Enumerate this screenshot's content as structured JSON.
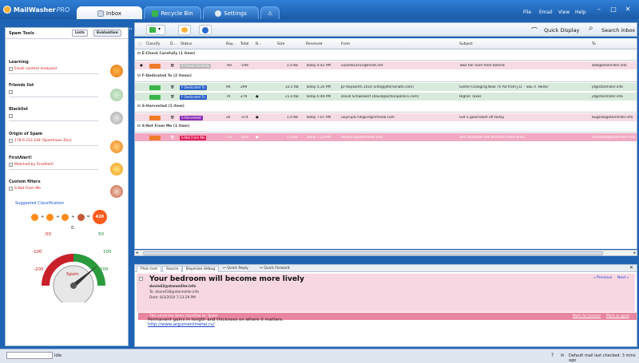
{
  "app": {
    "name": "MailWasher",
    "edition": "PRO"
  },
  "tabs": [
    {
      "label": "Inbox",
      "icon": "mail-icon"
    },
    {
      "label": "Recycle Bin",
      "icon": "recycle-icon"
    },
    {
      "label": "Settings",
      "icon": "gear-icon"
    },
    {
      "label": "",
      "icon": "warning-icon"
    }
  ],
  "menu": [
    "File",
    "Email",
    "View",
    "Help"
  ],
  "window": {
    "minimize": "–",
    "maximize": "□",
    "close": "✕"
  },
  "left": {
    "title": "Spam Tools",
    "seg_lists": "Lists",
    "seg_evaluation": "Evaluation",
    "tools": [
      {
        "title": "Learning",
        "value": "Email content analyzed",
        "badge": "70"
      },
      {
        "title": "Friends list",
        "value": ""
      },
      {
        "title": "Blacklist",
        "value": ""
      },
      {
        "title": "Origin of Spam",
        "value": "178.9.212.244 (Spamhaus Zen)",
        "badge": "100"
      },
      {
        "title": "FirstAlert!",
        "value": "Matched by FirstAlert!",
        "badge": "100"
      },
      {
        "title": "Custom filters",
        "value": "S-Not From Me",
        "badge": "150"
      }
    ],
    "suggested": "Suggested Classification",
    "total_score": "420",
    "gauge": {
      "labels": [
        "-200",
        "-100",
        "-50",
        "0",
        "50",
        "100",
        "200"
      ],
      "caption": "Spam",
      "needle_value": 420
    }
  },
  "toolbar": {
    "quick_display": "Quick Display",
    "search_inbox": "Search inbox"
  },
  "columns": [
    "Classify",
    "D...",
    "Status",
    "Bay...",
    "Total",
    "B...",
    "",
    "Size",
    "Received",
    "From",
    "Subject",
    "To"
  ],
  "groups": [
    {
      "label": "E-Check Carefully (1 item)",
      "rows": [
        {
          "style": "pink",
          "status": "E-Check Carefully",
          "status_color": "#b8b8b8",
          "bayes": "-69",
          "total": "-199",
          "attach": "",
          "size": "1.0 KB",
          "received": "Today 4:42 PM",
          "from": "vuzedos2010@hinet.net",
          "subject": "Take her hard from behind",
          "to": "web@stanmiller.info"
        }
      ]
    },
    {
      "label": "F-Dedicated To (2 items)",
      "rows": [
        {
          "style": "green",
          "status": "F-Dedicated To",
          "status_color": "#2a5fc8",
          "bayes": "99",
          "total": "299",
          "attach": "",
          "size": "33.5 KB",
          "received": "Today 5:35 PM",
          "from": "JD Hayworth 2010 (info@jdforsenate.com)",
          "subject": "Game-Changing New TV Ad from J.D. - SEE IT HERE!",
          "to": "jd@stanmiller.info"
        },
        {
          "style": "green",
          "status": "F-Dedicated To",
          "status_color": "#2a5fc8",
          "bayes": "79",
          "total": "279",
          "attach": "●",
          "size": "21.0 KB",
          "received": "Today 6:49 PM",
          "from": "David Schweikert (david@actionpolitics.com)",
          "subject": "Higher Taxes",
          "to": "jd@stanmiller.info"
        }
      ]
    },
    {
      "label": "S-Harvested (1 item)",
      "rows": [
        {
          "style": "pink",
          "status": "S-Harvested",
          "status_color": "#8a2bb5",
          "bayes": "26",
          "total": "-374",
          "attach": "●",
          "size": "1.0 KB",
          "received": "Today 7:07 PM",
          "from": "uoycup4756@virginmedia.com",
          "subject": "Get a good blast off today",
          "to": "bugzilla@stanmiller.info"
        }
      ]
    },
    {
      "label": "S-Not From Me (1 item)",
      "rows": [
        {
          "style": "hot",
          "status": "S-Not From Me",
          "status_color": "#e0205a",
          "bayes": "-70",
          "total": "-420",
          "attach": "●",
          "size": "1.0 KB",
          "received": "Today 7:23 PM",
          "from": "dovie43@stanmiller.info",
          "subject": "Your bedroom will become more lively",
          "to": "dovie430@stanmiller.info"
        }
      ]
    }
  ],
  "preview": {
    "tabs": [
      "Plain text",
      "Source",
      "Bayesian debug",
      "Quick Reply",
      "Quick Forward"
    ],
    "subject": "Your bedroom will become more lively",
    "from": "dovie43@stanmiller.info",
    "to_label": "To:",
    "to": "dovie430@stanmiller.info",
    "date_label": "Date:",
    "date": "8/3/2010 7:23:29 PM",
    "prev": "« Previous",
    "next": "Next »",
    "classified": "This email has been classified as: Spam",
    "mark_bounce": "Mark for bounce",
    "mark_good": "Mark as good",
    "body": "Permanent gains in length and thickness on where it matters.",
    "link": "http://www.argumentmetal.ru/"
  },
  "statusbar": {
    "left": "Idle",
    "right": "Default mail last checked: 3 mins ago"
  }
}
